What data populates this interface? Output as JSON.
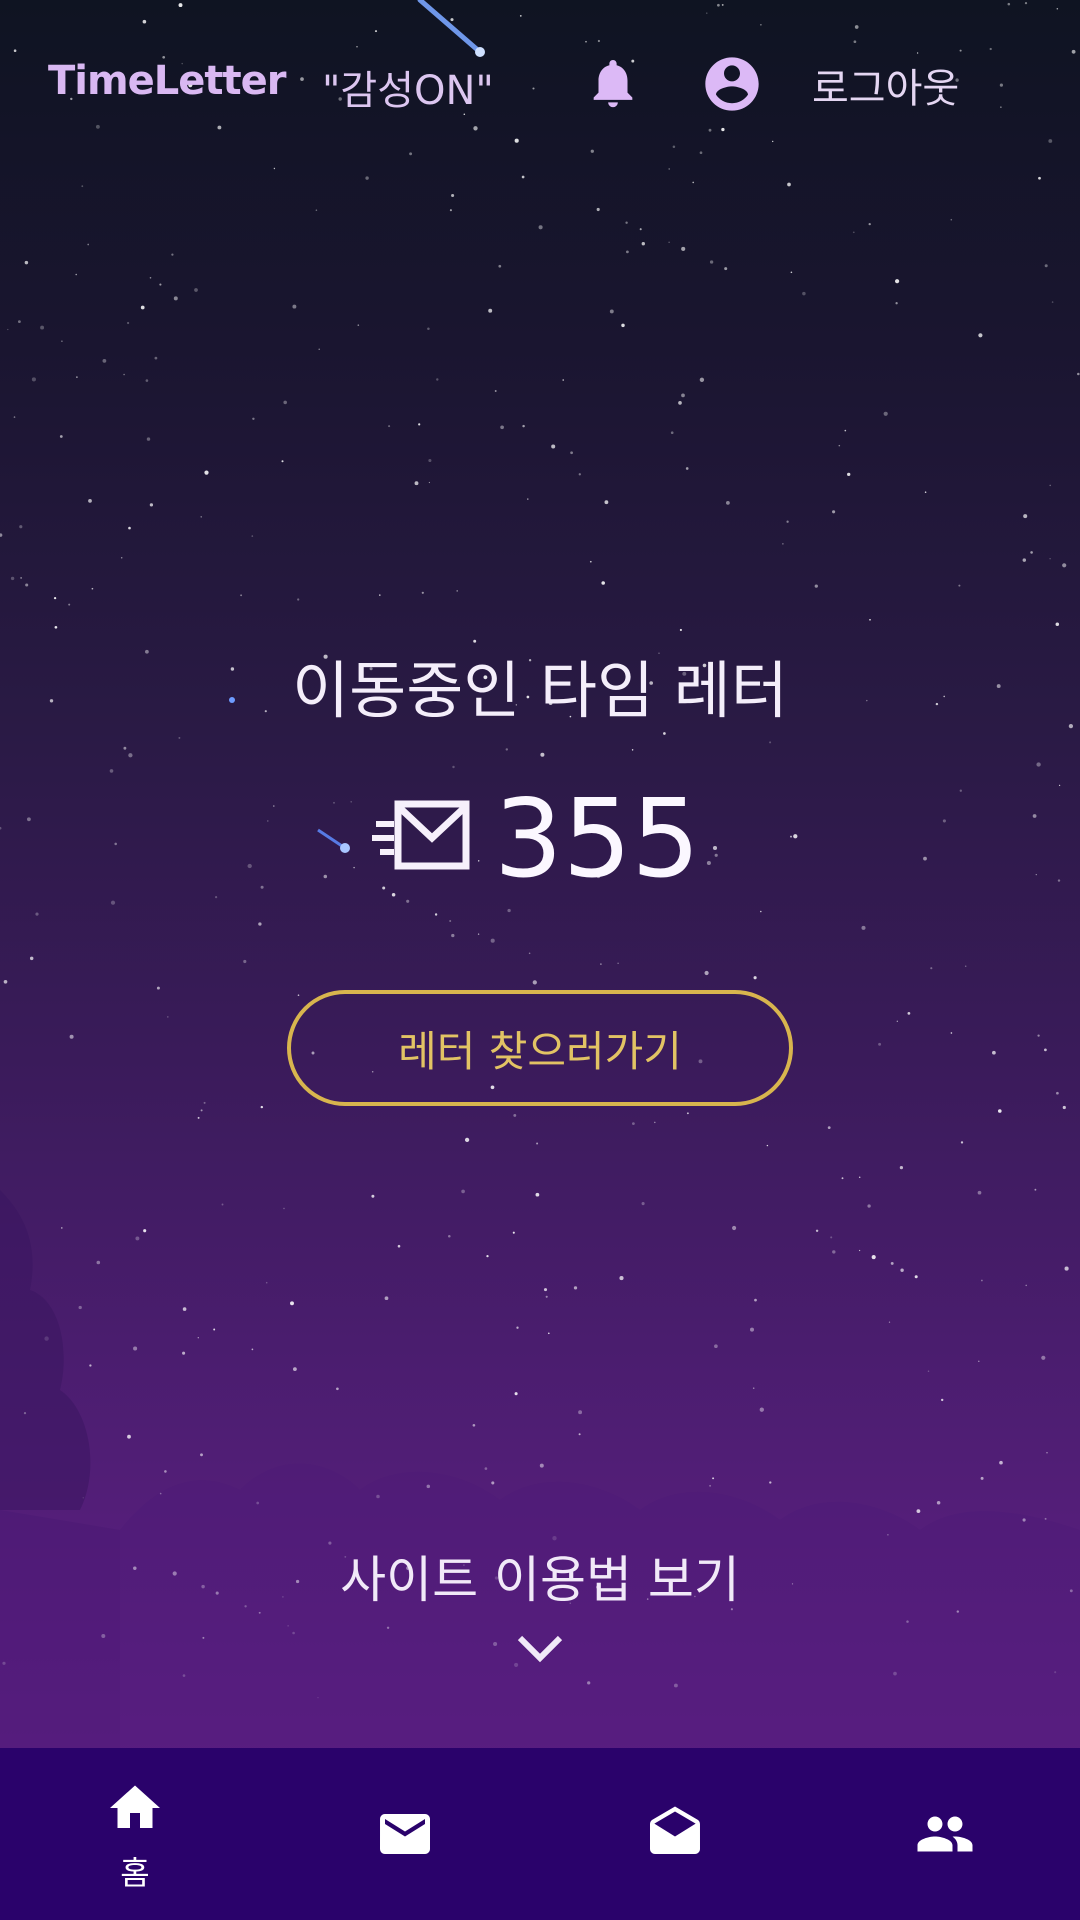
{
  "header": {
    "brand": "TimeLetter",
    "tagline": "\"감성ON\"",
    "icons": [
      "bell-icon",
      "account-circle-icon"
    ],
    "logout_label": "로그아웃"
  },
  "hero": {
    "title": "이동중인 타임 레터",
    "icon": "fast-mail-icon",
    "count": "355",
    "find_button_label": "레터 찾으러가기"
  },
  "guide": {
    "label": "사이트 이용법 보기",
    "icon": "chevron-down-icon"
  },
  "bottom_nav": {
    "items": [
      {
        "icon": "home-icon",
        "label": "홈",
        "active": true
      },
      {
        "icon": "mail-icon",
        "label": ""
      },
      {
        "icon": "open-mail-icon",
        "label": ""
      },
      {
        "icon": "people-icon",
        "label": ""
      }
    ]
  },
  "colors": {
    "brand": "#d9b8f2",
    "accent_gold": "#d8b54e",
    "nav_background": "#2a026b"
  }
}
